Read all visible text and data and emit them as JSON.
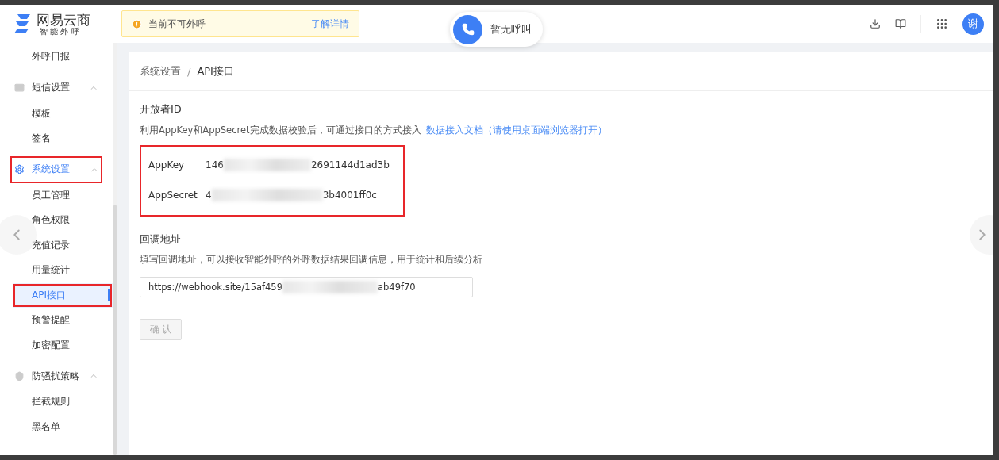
{
  "header": {
    "logo_title": "网易云商",
    "logo_subtitle": "智 能 外 呼",
    "notice": {
      "text": "当前不可外呼",
      "link": "了解详情"
    },
    "call_status": "暂无呼叫",
    "avatar": "谢"
  },
  "sidebar": {
    "items": [
      {
        "kind": "item",
        "label": "外呼日报",
        "selected": false,
        "annotated": false
      },
      {
        "kind": "group",
        "label": "短信设置",
        "selected": false,
        "expanded": true,
        "annotated": false,
        "children": [
          {
            "kind": "item",
            "label": "模板",
            "selected": false,
            "annotated": false
          },
          {
            "kind": "item",
            "label": "签名",
            "selected": false,
            "annotated": false
          }
        ]
      },
      {
        "kind": "group",
        "label": "系统设置",
        "selected": true,
        "expanded": true,
        "annotated": true,
        "children": [
          {
            "kind": "item",
            "label": "员工管理",
            "selected": false,
            "annotated": false
          },
          {
            "kind": "item",
            "label": "角色权限",
            "selected": false,
            "annotated": false
          },
          {
            "kind": "item",
            "label": "充值记录",
            "selected": false,
            "annotated": false
          },
          {
            "kind": "item",
            "label": "用量统计",
            "selected": false,
            "annotated": false
          },
          {
            "kind": "item",
            "label": "API接口",
            "selected": true,
            "annotated": true
          },
          {
            "kind": "item",
            "label": "预警提醒",
            "selected": false,
            "annotated": false
          },
          {
            "kind": "item",
            "label": "加密配置",
            "selected": false,
            "annotated": false
          }
        ]
      },
      {
        "kind": "group",
        "label": "防骚扰策略",
        "selected": false,
        "expanded": true,
        "annotated": false,
        "children": [
          {
            "kind": "item",
            "label": "拦截规则",
            "selected": false,
            "annotated": false
          },
          {
            "kind": "item",
            "label": "黑名单",
            "selected": false,
            "annotated": false
          }
        ]
      }
    ]
  },
  "breadcrumb": {
    "items": [
      "系统设置",
      "API接口"
    ],
    "separator": "/"
  },
  "developer": {
    "title": "开放者ID",
    "description": "利用AppKey和AppSecret完成数据校验后，可通过接口的方式接入",
    "link": "数据接入文档（请使用桌面端浏览器打开）",
    "annotated": true,
    "keys": [
      {
        "label": "AppKey",
        "value_start": "146",
        "value_end": "2691144d1ad3b"
      },
      {
        "label": "AppSecret",
        "value_start": "4",
        "value_end": "3b4001ff0c"
      }
    ]
  },
  "callback": {
    "title": "回调地址",
    "description": "填写回调地址，可以接收智能外呼的外呼数据结果回调信息，用于统计和后续分析",
    "value_start": "https://webhook.site/15af459",
    "value_end": "ab49f70",
    "button": "确 认",
    "button_disabled": true
  }
}
